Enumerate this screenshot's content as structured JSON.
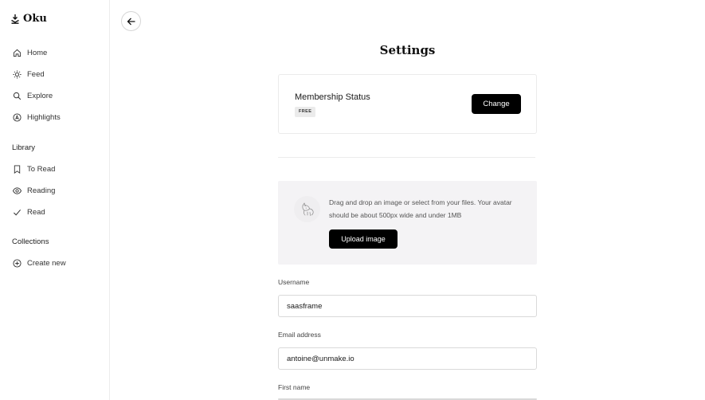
{
  "brand": {
    "name": "Oku"
  },
  "sidebar": {
    "nav": [
      {
        "label": "Home",
        "icon": "home-icon"
      },
      {
        "label": "Feed",
        "icon": "sun-icon"
      },
      {
        "label": "Explore",
        "icon": "search-icon"
      },
      {
        "label": "Highlights",
        "icon": "highlights-icon"
      }
    ],
    "library_title": "Library",
    "library": [
      {
        "label": "To Read",
        "icon": "bookmark-icon"
      },
      {
        "label": "Reading",
        "icon": "eye-icon"
      },
      {
        "label": "Read",
        "icon": "check-icon"
      }
    ],
    "collections_title": "Collections",
    "create_new": {
      "label": "Create new",
      "icon": "plus-circle-icon"
    }
  },
  "main": {
    "back_icon": "arrow-left-icon",
    "title": "Settings",
    "membership": {
      "label": "Membership Status",
      "badge": "FREE",
      "button": "Change"
    },
    "avatar": {
      "icon": "dog-sketch-avatar",
      "help_text": "Drag and drop an image or select from your files. Your avatar should be about 500px wide and under 1MB",
      "upload_button": "Upload image"
    },
    "fields": {
      "username": {
        "label": "Username",
        "value": "saasframe"
      },
      "email": {
        "label": "Email address",
        "value": "antoine@unmake.io"
      },
      "first_name": {
        "label": "First name"
      }
    }
  },
  "colors": {
    "accent": "#000000",
    "panel_bg": "#f4f3f5",
    "badge_bg": "#ebebeb"
  }
}
